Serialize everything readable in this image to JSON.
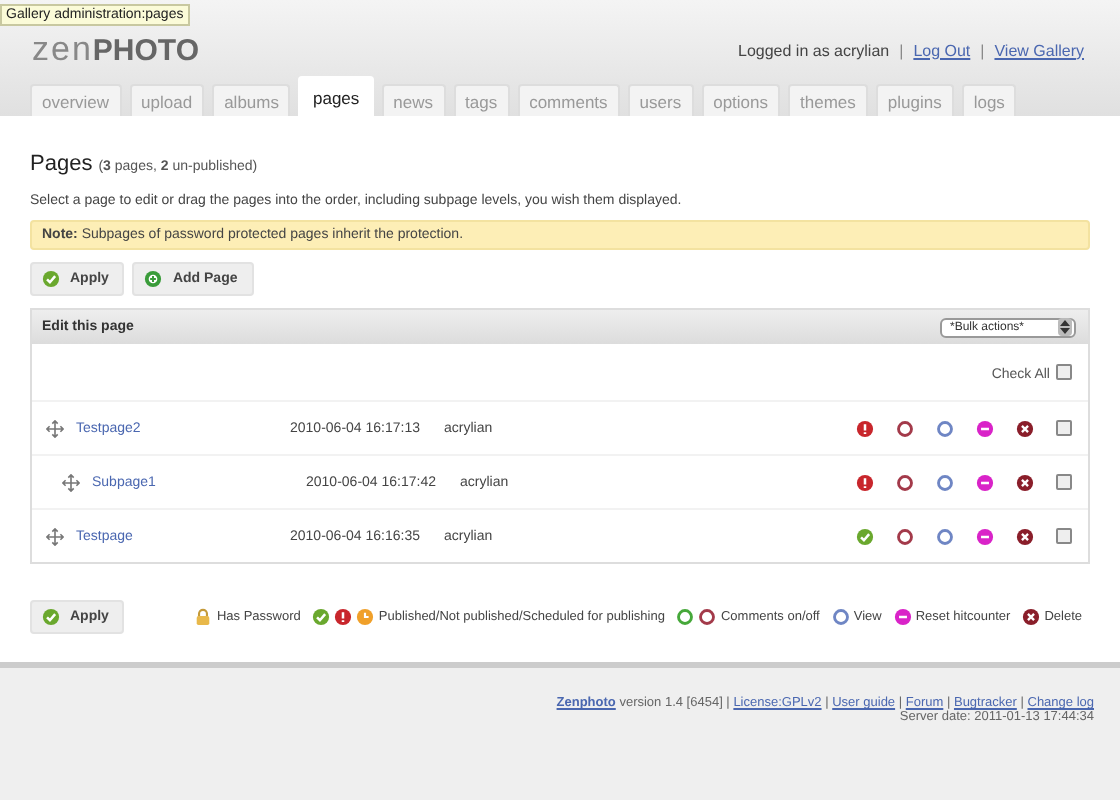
{
  "tooltip": "Gallery administration:pages",
  "logo": {
    "light": "zen",
    "bold": "PHOTO"
  },
  "user_bar": [
    {
      "kind": "text",
      "text": "Logged in as acrylian"
    },
    {
      "kind": "text",
      "text": "|"
    },
    {
      "kind": "link",
      "text": "Log Out"
    },
    {
      "kind": "text",
      "text": "|"
    },
    {
      "kind": "link",
      "text": "View Gallery"
    }
  ],
  "tabs": [
    {
      "label": "overview",
      "selected": false
    },
    {
      "label": "upload",
      "selected": false
    },
    {
      "label": "albums",
      "selected": false
    },
    {
      "label": "pages",
      "selected": true
    },
    {
      "label": "news",
      "selected": false
    },
    {
      "label": "tags",
      "selected": false
    },
    {
      "label": "comments",
      "selected": false
    },
    {
      "label": "users",
      "selected": false
    },
    {
      "label": "options",
      "selected": false
    },
    {
      "label": "themes",
      "selected": false
    },
    {
      "label": "plugins",
      "selected": false
    },
    {
      "label": "logs",
      "selected": false
    }
  ],
  "heading": {
    "title": "Pages",
    "summary": "(**3** pages, **2** un-published)"
  },
  "intro": "Select a page to edit or drag the pages into the order, including subpage levels, you wish them displayed.",
  "note": "**Note:** Subpages of password protected pages inherit the protection.",
  "buttons": [
    {
      "label": "Apply",
      "kind": "apply"
    },
    {
      "label": "Add Page",
      "kind": "add"
    }
  ],
  "panel": {
    "title": "Edit this page",
    "bulk_select": "*Bulk actions*",
    "check_all": {
      "label": "Check All",
      "checked": false
    },
    "rows": [
      {
        "title": "Testpage2",
        "date": "2010-06-04 16:17:13",
        "author": "acrylian",
        "published": false,
        "checked": false,
        "children": [
          {
            "title": "Subpage1",
            "date": "2010-06-04 16:17:42",
            "author": "acrylian",
            "published": false,
            "checked": false
          }
        ]
      },
      {
        "title": "Testpage",
        "date": "2010-06-04 16:16:35",
        "author": "acrylian",
        "published": true,
        "checked": false
      }
    ]
  },
  "bottom_button": {
    "label": "Apply",
    "kind": "apply"
  },
  "legend": [
    {
      "kind": "password",
      "label": "Has Password"
    },
    {
      "kind": "status",
      "label": "Published/Not published/Scheduled for publishing"
    },
    {
      "kind": "comments",
      "label": "Comments on/off"
    },
    {
      "kind": "view",
      "label": "View"
    },
    {
      "kind": "reset",
      "label": "Reset hitcounter"
    },
    {
      "kind": "delete",
      "label": "Delete"
    }
  ],
  "footer": {
    "items": [
      {
        "kind": "brand",
        "text": "Zenphoto"
      },
      {
        "kind": "text",
        "text": "version 1.4 [6454] |"
      },
      {
        "kind": "link",
        "text": "License:GPLv2"
      },
      {
        "kind": "text",
        "text": "|"
      },
      {
        "kind": "link",
        "text": "User guide"
      },
      {
        "kind": "text",
        "text": "|"
      },
      {
        "kind": "link",
        "text": "Forum"
      },
      {
        "kind": "text",
        "text": "|"
      },
      {
        "kind": "link",
        "text": "Bugtracker"
      },
      {
        "kind": "text",
        "text": "|"
      },
      {
        "kind": "link",
        "text": "Change log"
      }
    ],
    "server_date": "Server date: 2011-01-13 17:44:34"
  }
}
